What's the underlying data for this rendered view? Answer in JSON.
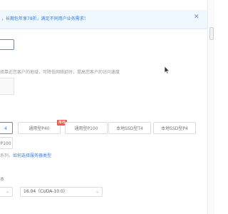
{
  "banner": {
    "text": "，长期包年享78折，满足不同用户业务需求！",
    "close_icon": "close-icon"
  },
  "region_hint": "择靠近您客户的地域，可降低网络延时，提高您客户的访问速度",
  "badge": "推荐",
  "gpu_cards": [
    {
      "label": "4",
      "selected": true
    },
    {
      "label": "通用型P40"
    },
    {
      "label": "通用型P100"
    },
    {
      "label": "本地SSD型T4"
    },
    {
      "label": "本地SSD型P4"
    }
  ],
  "gpu_card_row2": "P100",
  "tip": {
    "text": "系列，",
    "link": "如何选择服务器类型"
  },
  "image_section_label": "本",
  "os_select": {
    "value": "",
    "chevron_icon": "chevron-down-icon"
  },
  "version_select": {
    "value": "16.04（CUDA-10.0）",
    "chevron_icon": "chevron-down-icon"
  }
}
